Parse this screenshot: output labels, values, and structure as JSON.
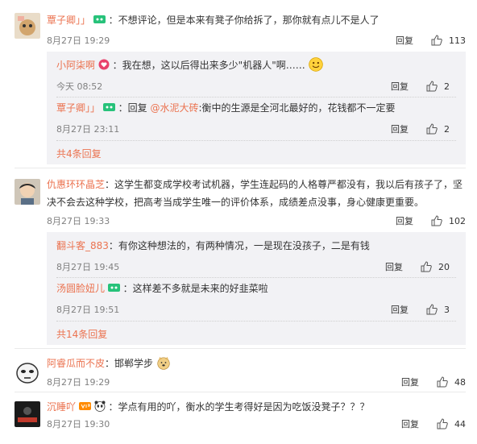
{
  "comments": [
    {
      "user": "覃子卿」」",
      "text": "：不想评论，但是本来有凳子你给拆了，那你就有点儿不是人了",
      "time": "8月27日 19:29",
      "reply_label": "回复",
      "likes": "113",
      "replies": [
        {
          "user": "小阿柒啊",
          "text": "：我在想，这以后得出来多少\"机器人\"啊……",
          "time": "今天 08:52",
          "reply_label": "回复",
          "likes": "2"
        },
        {
          "user": "覃子卿」」",
          "prefix": "：回复 ",
          "mention": "@水泥大砖",
          "text": ":衡中的生源是全河北最好的，花钱都不一定要",
          "time": "8月27日 23:11",
          "reply_label": "回复",
          "likes": "2"
        }
      ],
      "more_replies": "共4条回复"
    },
    {
      "user": "仇惠环环晶芝",
      "text": "：这学生都变成学校考试机器，学生连起码的人格尊严都没有，我以后有孩子了，坚决不会去这种学校，把高考当成学生唯一的评价体系，成绩差点没事，身心健康更重要。",
      "time": "8月27日 19:33",
      "reply_label": "回复",
      "likes": "102",
      "replies": [
        {
          "user": "翻斗客_883",
          "text": "：有你这种想法的，有两种情况，一是现在没孩子，二是有钱",
          "time": "8月27日 19:45",
          "reply_label": "回复",
          "likes": "20"
        },
        {
          "user": "汤圆脸妞儿",
          "text": "：这样差不多就是未来的好韭菜啦",
          "time": "8月27日 19:51",
          "reply_label": "回复",
          "likes": "3"
        }
      ],
      "more_replies": "共14条回复"
    },
    {
      "user": "阿睿瓜而不皮",
      "text": "：邯郸学步",
      "time": "8月27日 19:29",
      "reply_label": "回复",
      "likes": "48"
    },
    {
      "user": "沉睡吖",
      "text": "：学点有用的吖，衡水的学生考得好是因为吃饭没凳子？？？",
      "time": "8月27日 19:30",
      "reply_label": "回复",
      "likes": "44"
    }
  ],
  "colors": {
    "link": "#eb7350",
    "badge": "#27c27a",
    "subbg": "#f2f2f5"
  },
  "icons": {
    "like": "thumbs-up-icon",
    "badge": "member-badge-icon"
  }
}
